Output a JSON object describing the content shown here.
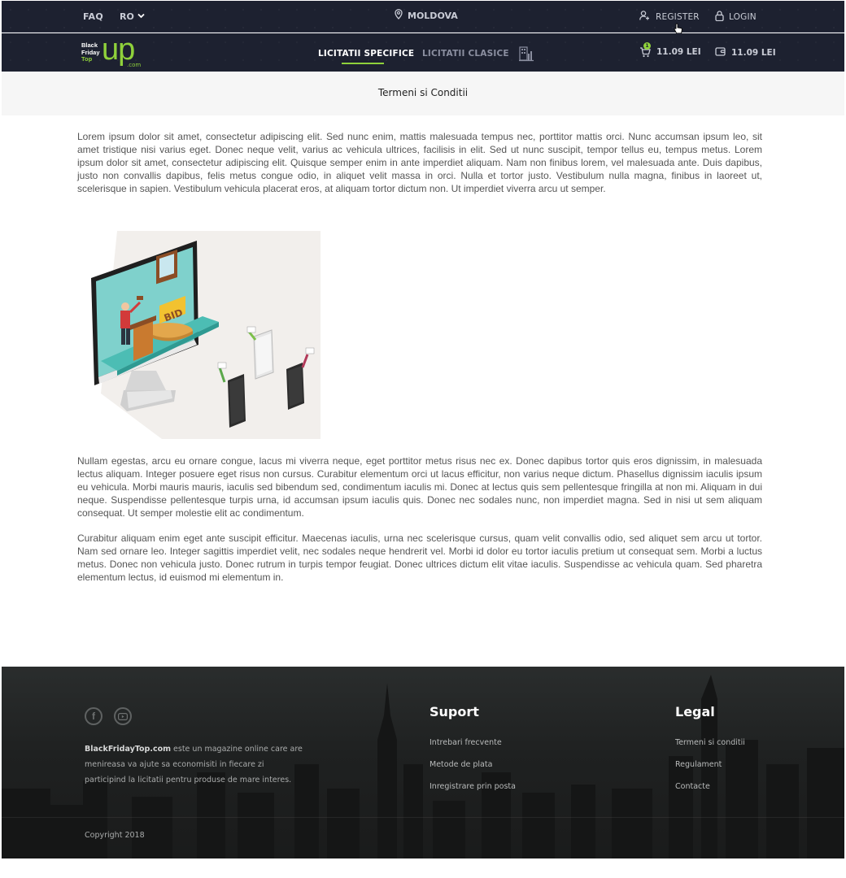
{
  "topbar": {
    "faq": "FAQ",
    "language": "RO",
    "location": "MOLDOVA",
    "register": "REGISTER",
    "login": "LOGIN"
  },
  "navbar": {
    "logo": {
      "line1": "Black",
      "line2": "Friday",
      "line3": "Top",
      "up": "up",
      "com": ".com"
    },
    "tabs": [
      {
        "label": "LICITATII SPECIFICE",
        "active": true
      },
      {
        "label": "LICITATII CLASICE",
        "active": false
      }
    ],
    "cart_badge": "1",
    "cart_amount": "11.09 LEI",
    "wallet_amount": "11.09 LEI"
  },
  "page": {
    "title": "Termeni si Conditii"
  },
  "content": {
    "paragraph1": "Lorem ipsum dolor sit amet, consectetur adipiscing elit. Sed nunc enim, mattis malesuada tempus nec, porttitor mattis orci. Nunc accumsan ipsum leo, sit amet tristique nisi varius eget. Donec neque velit, varius ac vehicula ultrices, facilisis in elit. Sed ut nunc suscipit, tempor tellus eu, tempus metus. Lorem ipsum dolor sit amet, consectetur adipiscing elit. Quisque semper enim in ante imperdiet aliquam. Nam non finibus lorem, vel malesuada ante. Duis dapibus, justo non convallis dapibus, felis metus congue odio, in aliquet velit massa in orci. Nulla et tortor justo. Vestibulum nulla magna, finibus in laoreet ut, scelerisque in sapien. Vestibulum vehicula placerat eros, at aliquam tortor dictum non. Ut imperdiet viverra arcu ut semper.",
    "illustration_sign": "BID",
    "paragraph2": "Nullam egestas, arcu eu ornare congue, lacus mi viverra neque, eget porttitor metus risus nec ex. Donec dapibus tortor quis eros dignissim, in malesuada lectus aliquam. Integer posuere eget risus non cursus. Curabitur elementum orci ut lacus efficitur, non varius neque dictum. Phasellus dignissim iaculis ipsum eu vehicula. Morbi mauris mauris, iaculis sed bibendum sed, condimentum iaculis mi. Donec at lectus quis sem pellentesque fringilla at non mi. Aliquam in dui neque. Suspendisse pellentesque turpis urna, id accumsan ipsum iaculis quis. Donec nec sodales nunc, non imperdiet magna. Sed in nisi ut sem aliquam consequat. Ut semper molestie elit ac condimentum.",
    "paragraph3": "Curabitur aliquam enim eget ante suscipit efficitur. Maecenas iaculis, urna nec scelerisque cursus, quam velit convallis odio, sed aliquet sem arcu ut tortor. Nam sed ornare leo. Integer sagittis imperdiet velit, nec sodales neque hendrerit vel. Morbi id dolor eu tortor iaculis pretium ut consequat sem. Morbi a luctus metus. Donec non vehicula justo. Donec rutrum in turpis tempor feugiat. Donec ultrices dictum elit vitae iaculis. Suspendisse ac vehicula quam. Sed pharetra elementum lectus, id euismod mi elementum in."
  },
  "footer": {
    "social_facebook": "f",
    "about_brand": "BlackFridayTop.com",
    "about_text": " este un magazine online care are menireasa va ajute sa economisiti in fiecare zi participind la licitatii pentru produse de mare interes.",
    "suport_title": "Suport",
    "suport_links": [
      "Intrebari frecvente",
      "Metode de plata",
      "Inregistrare prin posta"
    ],
    "legal_title": "Legal",
    "legal_links": [
      "Termeni si conditii",
      "Regulament",
      "Contacte"
    ],
    "copyright": "Copyright 2018"
  },
  "colors": {
    "header_bg": "#1d2130",
    "accent": "#8fd13b",
    "footer_bg": "#1f2121"
  },
  "icons": [
    "location-pin-icon",
    "user-plus-icon",
    "lock-icon",
    "chevron-down-icon",
    "cart-icon",
    "wallet-icon",
    "building-chart-icon",
    "facebook-icon",
    "youtube-icon",
    "hand-cursor-icon"
  ]
}
